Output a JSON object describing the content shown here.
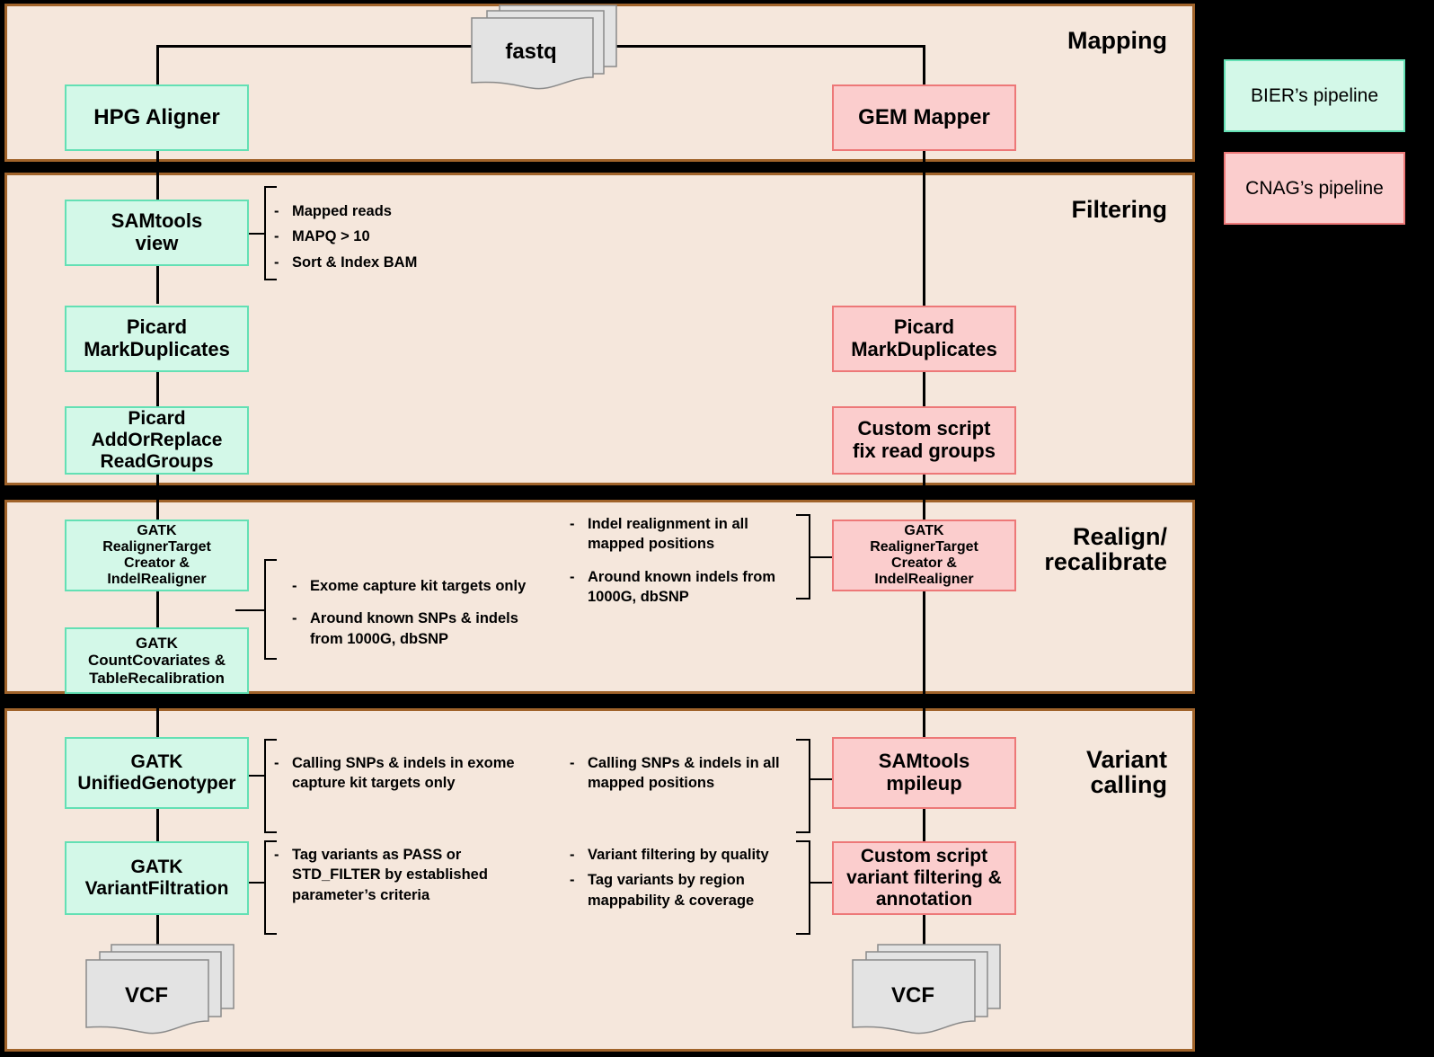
{
  "colors": {
    "panel_bg": "#f5e7dc",
    "panel_border": "#a0632a",
    "bier_fill": "#d3f8e8",
    "bier_border": "#63e0b4",
    "cnag_fill": "#fbcdcd",
    "cnag_border": "#ed7878",
    "doc_fill": "#e3e3e3",
    "doc_border": "#8a8a8a",
    "outside_bg": "#000000",
    "line": "#000000"
  },
  "legend": {
    "bier_label": "BIER’s pipeline",
    "cnag_label": "CNAG’s pipeline"
  },
  "sections": {
    "mapping": {
      "title": "Mapping"
    },
    "filtering": {
      "title": "Filtering"
    },
    "realign": {
      "title": "Realign/\nrecalibrate"
    },
    "variant": {
      "title": "Variant\ncalling"
    }
  },
  "documents": {
    "fastq": {
      "label": "fastq"
    },
    "vcf_left": {
      "label": "VCF"
    },
    "vcf_right": {
      "label": "VCF"
    }
  },
  "nodes": {
    "hpg_aligner": {
      "label": "HPG Aligner",
      "pipeline": "bier"
    },
    "gem_mapper": {
      "label": "GEM Mapper",
      "pipeline": "cnag"
    },
    "samtools_view": {
      "label": "SAMtools\nview",
      "pipeline": "bier"
    },
    "picard_markdup_left": {
      "label": "Picard\nMarkDuplicates",
      "pipeline": "bier"
    },
    "picard_addorreplace": {
      "label": "Picard\nAddOrReplace\nReadGroups",
      "pipeline": "bier"
    },
    "picard_markdup_right": {
      "label": "Picard\nMarkDuplicates",
      "pipeline": "cnag"
    },
    "custom_fix_rg": {
      "label": "Custom script\nfix read groups",
      "pipeline": "cnag"
    },
    "gatk_realigner_left": {
      "label": "GATK\nRealignerTarget\nCreator &\nIndelRealigner",
      "pipeline": "bier"
    },
    "gatk_countcov": {
      "label": "GATK\nCountCovariates &\nTableRecalibration",
      "pipeline": "bier"
    },
    "gatk_realigner_right": {
      "label": "GATK\nRealignerTarget\nCreator &\nIndelRealigner",
      "pipeline": "cnag"
    },
    "gatk_unifiedgenotyper": {
      "label": "GATK\nUnifiedGenotyper",
      "pipeline": "bier"
    },
    "gatk_variantfiltration": {
      "label": "GATK\nVariantFiltration",
      "pipeline": "bier"
    },
    "samtools_mpileup": {
      "label": "SAMtools\nmpileup",
      "pipeline": "cnag"
    },
    "custom_variant_filter": {
      "label": "Custom script\nvariant filtering &\nannotation",
      "pipeline": "cnag"
    }
  },
  "annotations": {
    "samtools_view_notes": {
      "items": [
        "Mapped reads",
        "MAPQ > 10",
        "Sort & Index BAM"
      ]
    },
    "gatk_realign_left_notes": {
      "items": [
        "Exome capture kit targets only",
        "Around known SNPs & indels\nfrom 1000G, dbSNP"
      ]
    },
    "gatk_realign_right_notes": {
      "items": [
        "Indel realignment in all\nmapped positions",
        "Around known indels from\n1000G, dbSNP"
      ]
    },
    "unified_genotyper_notes": {
      "items": [
        "Calling SNPs & indels in exome\ncapture kit targets only"
      ]
    },
    "variant_filtration_notes": {
      "items": [
        "Tag variants as PASS or\nSTD_FILTER by established\nparameter’s criteria"
      ]
    },
    "mpileup_notes": {
      "items": [
        "Calling SNPs & indels in all\nmapped positions"
      ]
    },
    "custom_variant_notes": {
      "items": [
        "Variant filtering by quality",
        "Tag variants by region\nmappability & coverage"
      ]
    }
  }
}
